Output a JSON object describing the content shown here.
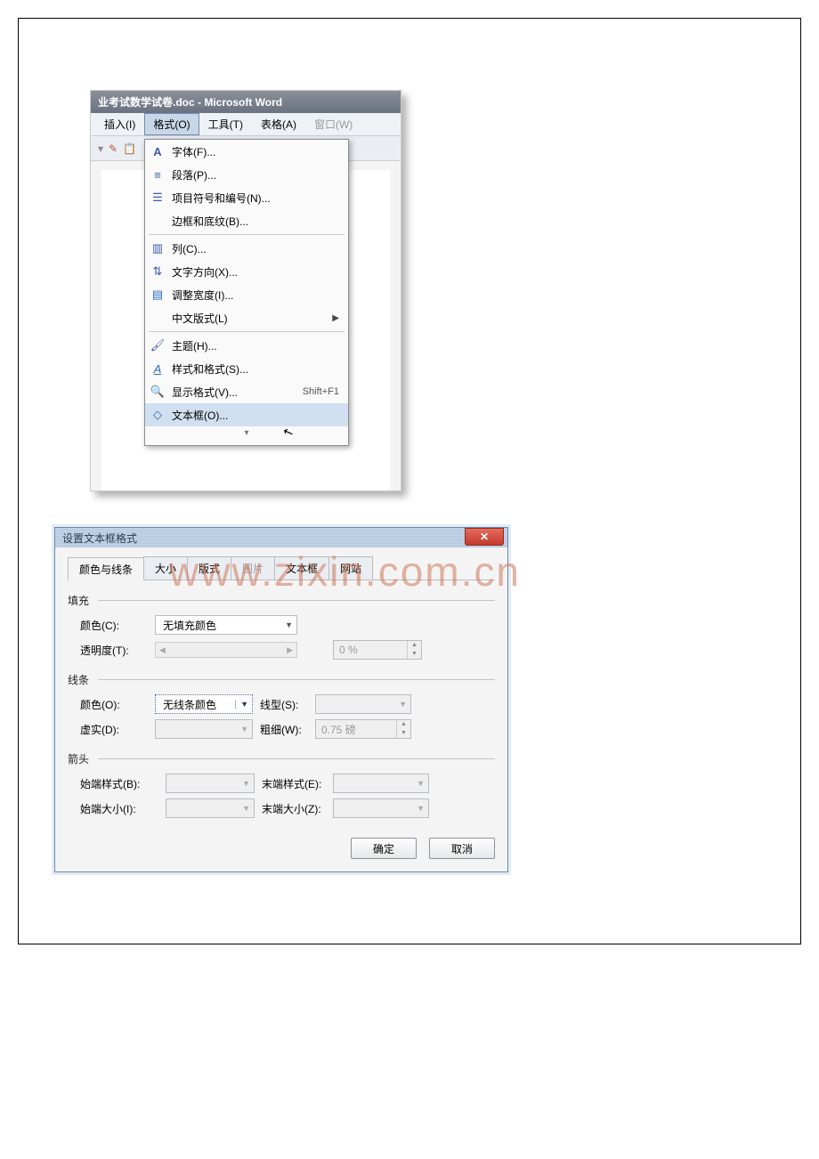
{
  "watermark": "www.zixin.com.cn",
  "word": {
    "title": "业考试数学试卷.doc - Microsoft Word",
    "menubar": {
      "insert": "插入(I)",
      "format": "格式(O)",
      "tools": "工具(T)",
      "table": "表格(A)",
      "window": "窗口(W)"
    },
    "dropdown": {
      "items": [
        {
          "key": "font",
          "icon": "A",
          "label": "字体(F)..."
        },
        {
          "key": "paragraph",
          "icon": "≡",
          "label": "段落(P)..."
        },
        {
          "key": "bullets",
          "icon": "☰",
          "label": "项目符号和编号(N)..."
        },
        {
          "key": "borders",
          "icon": "",
          "label": "边框和底纹(B)..."
        },
        {
          "key": "columns",
          "icon": "▥",
          "label": "列(C)..."
        },
        {
          "key": "direction",
          "icon": "⇅",
          "label": "文字方向(X)..."
        },
        {
          "key": "width",
          "icon": "▤",
          "label": "调整宽度(I)..."
        },
        {
          "key": "chinese",
          "icon": "",
          "label": "中文版式(L)",
          "arrow": true
        },
        {
          "key": "theme",
          "icon": "🖌",
          "label": "主题(H)..."
        },
        {
          "key": "styles",
          "icon": "A",
          "label": "样式和格式(S)..."
        },
        {
          "key": "reveal",
          "icon": "🔍",
          "label": "显示格式(V)...",
          "shortcut": "Shift+F1"
        },
        {
          "key": "textbox",
          "icon": "◇",
          "label": "文本框(O)...",
          "highlight": true
        }
      ]
    }
  },
  "dialog": {
    "title": "设置文本框格式",
    "tabs": {
      "colors": "颜色与线条",
      "size": "大小",
      "layout": "版式",
      "picture": "图片",
      "textbox": "文本框",
      "web": "网站"
    },
    "sections": {
      "fill": "填充",
      "line": "线条",
      "arrow": "箭头"
    },
    "fill": {
      "color_label": "颜色(C):",
      "color_value": "无填充颜色",
      "trans_label": "透明度(T):",
      "trans_value": "0 %"
    },
    "line": {
      "color_label": "颜色(O):",
      "color_value": "无线条颜色",
      "style_label": "线型(S):",
      "dash_label": "虚实(D):",
      "weight_label": "粗细(W):",
      "weight_value": "0.75 磅"
    },
    "arrow": {
      "begin_style_label": "始端样式(B):",
      "end_style_label": "末端样式(E):",
      "begin_size_label": "始端大小(I):",
      "end_size_label": "末端大小(Z):"
    },
    "buttons": {
      "ok": "确定",
      "cancel": "取消"
    }
  }
}
